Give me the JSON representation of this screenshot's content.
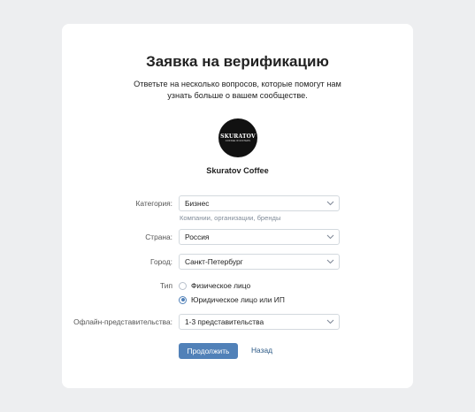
{
  "form": {
    "title": "Заявка на верификацию",
    "subtitle": "Ответьте на несколько вопросов, которые помогут нам узнать больше о вашем сообществе."
  },
  "community": {
    "name": "Skuratov Coffee",
    "logo_text": "SKURATOV",
    "logo_subtext": "COFFEE ROASTERS"
  },
  "fields": {
    "category": {
      "label": "Категория:",
      "value": "Бизнес",
      "hint": "Компании, организации, бренды"
    },
    "country": {
      "label": "Страна:",
      "value": "Россия"
    },
    "city": {
      "label": "Город:",
      "value": "Санкт-Петербург"
    },
    "type": {
      "label": "Тип",
      "options": [
        "Физическое лицо",
        "Юридическое лицо или ИП"
      ],
      "selected": "Юридическое лицо или ИП"
    },
    "offline": {
      "label": "Офлайн-представительства:",
      "value": "1-3 представительства"
    }
  },
  "actions": {
    "continue_label": "Продолжить",
    "back_label": "Назад"
  },
  "colors": {
    "accent": "#5181b8",
    "link": "#2a5885",
    "background": "#edeef0",
    "card": "#ffffff"
  },
  "icons": {
    "dropdown": "chevron-down-icon"
  }
}
